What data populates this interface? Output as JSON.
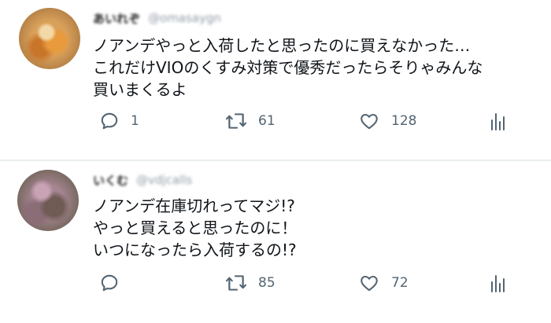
{
  "tweets": [
    {
      "display_name": "あいれぞ",
      "handle": "@omasaygn",
      "text": "ノアンデやっと入荷したと思ったのに買えなかった…\nこれだけVIOのくすみ対策で優秀だったらそりゃみんな\n買いまくるよ",
      "replies": "1",
      "retweets": "61",
      "likes": "128"
    },
    {
      "display_name": "いくむ",
      "handle": "@vdjcalls",
      "text": "ノアンデ在庫切れってマジ!?\nやっと買えると思ったのに！\nいつになったら入荷するの!?",
      "replies": "",
      "retweets": "85",
      "likes": "72"
    }
  ],
  "icons": {
    "reply": "reply-icon",
    "retweet": "retweet-icon",
    "like": "heart-icon",
    "share": "analytics-icon"
  },
  "colors": {
    "icon": "#536471",
    "divider": "#e8ecef",
    "text": "#0f1419"
  }
}
